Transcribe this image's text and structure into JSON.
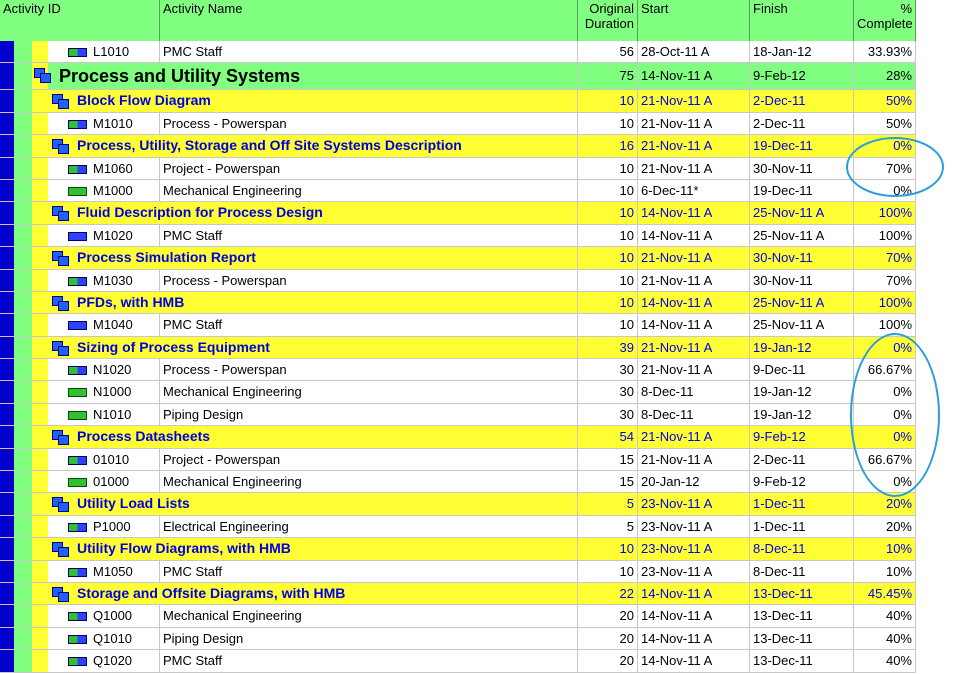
{
  "header": {
    "activity_id": "Activity ID",
    "activity_name": "Activity Name",
    "original_duration": "Original Duration",
    "start": "Start",
    "finish": "Finish",
    "percent_complete": "% Complete"
  },
  "rows": [
    {
      "type": "task",
      "icon": "mixed",
      "id": "L1010",
      "name": "PMC Staff",
      "dur": "56",
      "start": "28-Oct-11 A",
      "finish": "18-Jan-12",
      "pct": "33.93%"
    },
    {
      "type": "wbs1",
      "name": "Process and Utility Systems",
      "dur": "75",
      "start": "14-Nov-11 A",
      "finish": "9-Feb-12",
      "pct": "28%"
    },
    {
      "type": "wbs2",
      "name": "Block Flow Diagram",
      "dur": "10",
      "start": "21-Nov-11 A",
      "finish": "2-Dec-11",
      "pct": "50%"
    },
    {
      "type": "task",
      "icon": "mixed",
      "id": "M1010",
      "name": "Process - Powerspan",
      "dur": "10",
      "start": "21-Nov-11 A",
      "finish": "2-Dec-11",
      "pct": "50%"
    },
    {
      "type": "wbs2",
      "name": "Process, Utility, Storage and Off Site Systems Description",
      "dur": "16",
      "start": "21-Nov-11 A",
      "finish": "19-Dec-11",
      "pct": "0%"
    },
    {
      "type": "task",
      "icon": "mixed",
      "id": "M1060",
      "name": "Project - Powerspan",
      "dur": "10",
      "start": "21-Nov-11 A",
      "finish": "30-Nov-11",
      "pct": "70%"
    },
    {
      "type": "task",
      "icon": "green",
      "id": "M1000",
      "name": "Mechanical Engineering",
      "dur": "10",
      "start": "6-Dec-11*",
      "finish": "19-Dec-11",
      "pct": "0%"
    },
    {
      "type": "wbs2",
      "name": "Fluid Description for Process Design",
      "dur": "10",
      "start": "14-Nov-11 A",
      "finish": "25-Nov-11 A",
      "pct": "100%"
    },
    {
      "type": "task",
      "icon": "blue",
      "id": "M1020",
      "name": "PMC Staff",
      "dur": "10",
      "start": "14-Nov-11 A",
      "finish": "25-Nov-11 A",
      "pct": "100%"
    },
    {
      "type": "wbs2",
      "name": "Process Simulation Report",
      "dur": "10",
      "start": "21-Nov-11 A",
      "finish": "30-Nov-11",
      "pct": "70%"
    },
    {
      "type": "task",
      "icon": "mixed",
      "id": "M1030",
      "name": "Process - Powerspan",
      "dur": "10",
      "start": "21-Nov-11 A",
      "finish": "30-Nov-11",
      "pct": "70%"
    },
    {
      "type": "wbs2",
      "name": "PFDs, with HMB",
      "dur": "10",
      "start": "14-Nov-11 A",
      "finish": "25-Nov-11 A",
      "pct": "100%"
    },
    {
      "type": "task",
      "icon": "blue",
      "id": "M1040",
      "name": "PMC Staff",
      "dur": "10",
      "start": "14-Nov-11 A",
      "finish": "25-Nov-11 A",
      "pct": "100%"
    },
    {
      "type": "wbs2",
      "name": "Sizing of Process Equipment",
      "dur": "39",
      "start": "21-Nov-11 A",
      "finish": "19-Jan-12",
      "pct": "0%"
    },
    {
      "type": "task",
      "icon": "mixed",
      "id": "N1020",
      "name": "Process - Powerspan",
      "dur": "30",
      "start": "21-Nov-11 A",
      "finish": "9-Dec-11",
      "pct": "66.67%"
    },
    {
      "type": "task",
      "icon": "green",
      "id": "N1000",
      "name": "Mechanical Engineering",
      "dur": "30",
      "start": "8-Dec-11",
      "finish": "19-Jan-12",
      "pct": "0%"
    },
    {
      "type": "task",
      "icon": "green",
      "id": "N1010",
      "name": "Piping Design",
      "dur": "30",
      "start": "8-Dec-11",
      "finish": "19-Jan-12",
      "pct": "0%"
    },
    {
      "type": "wbs2",
      "name": "Process Datasheets",
      "dur": "54",
      "start": "21-Nov-11 A",
      "finish": "9-Feb-12",
      "pct": "0%"
    },
    {
      "type": "task",
      "icon": "mixed",
      "id": "01010",
      "name": "Project - Powerspan",
      "dur": "15",
      "start": "21-Nov-11 A",
      "finish": "2-Dec-11",
      "pct": "66.67%"
    },
    {
      "type": "task",
      "icon": "green",
      "id": "01000",
      "name": "Mechanical Engineering",
      "dur": "15",
      "start": "20-Jan-12",
      "finish": "9-Feb-12",
      "pct": "0%"
    },
    {
      "type": "wbs2",
      "name": "Utility Load Lists",
      "dur": "5",
      "start": "23-Nov-11 A",
      "finish": "1-Dec-11",
      "pct": "20%"
    },
    {
      "type": "task",
      "icon": "mixed",
      "id": "P1000",
      "name": "Electrical Engineering",
      "dur": "5",
      "start": "23-Nov-11 A",
      "finish": "1-Dec-11",
      "pct": "20%"
    },
    {
      "type": "wbs2",
      "name": "Utility Flow Diagrams, with HMB",
      "dur": "10",
      "start": "23-Nov-11 A",
      "finish": "8-Dec-11",
      "pct": "10%"
    },
    {
      "type": "task",
      "icon": "mixed",
      "id": "M1050",
      "name": "PMC Staff",
      "dur": "10",
      "start": "23-Nov-11 A",
      "finish": "8-Dec-11",
      "pct": "10%"
    },
    {
      "type": "wbs2",
      "name": "Storage and Offsite Diagrams, with HMB",
      "dur": "22",
      "start": "14-Nov-11 A",
      "finish": "13-Dec-11",
      "pct": "45.45%"
    },
    {
      "type": "task",
      "icon": "mixed",
      "id": "Q1000",
      "name": "Mechanical Engineering",
      "dur": "20",
      "start": "14-Nov-11 A",
      "finish": "13-Dec-11",
      "pct": "40%"
    },
    {
      "type": "task",
      "icon": "mixed",
      "id": "Q1010",
      "name": "Piping Design",
      "dur": "20",
      "start": "14-Nov-11 A",
      "finish": "13-Dec-11",
      "pct": "40%"
    },
    {
      "type": "task",
      "icon": "mixed",
      "id": "Q1020",
      "name": "PMC Staff",
      "dur": "20",
      "start": "14-Nov-11 A",
      "finish": "13-Dec-11",
      "pct": "40%"
    }
  ]
}
